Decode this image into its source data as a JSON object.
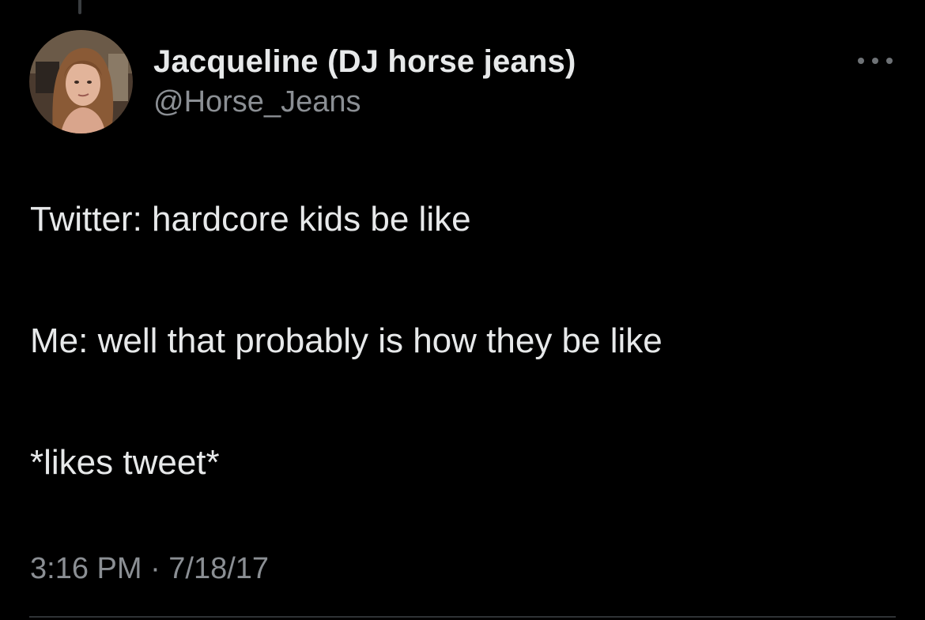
{
  "tweet": {
    "author": {
      "display_name": "Jacqueline (DJ horse jeans)",
      "handle": "@Horse_Jeans",
      "avatar": "profile-photo"
    },
    "menu_icon": "more-horizontal-icon",
    "lines": [
      "Twitter: hardcore kids be like",
      "Me: well that probably is how they be like",
      "*likes tweet*"
    ],
    "timestamp": "3:16 PM · 7/18/17"
  },
  "colors": {
    "background": "#000000",
    "primary_text": "#e7e9ea",
    "secondary_text": "#8b8f94",
    "divider": "#2f3336"
  }
}
